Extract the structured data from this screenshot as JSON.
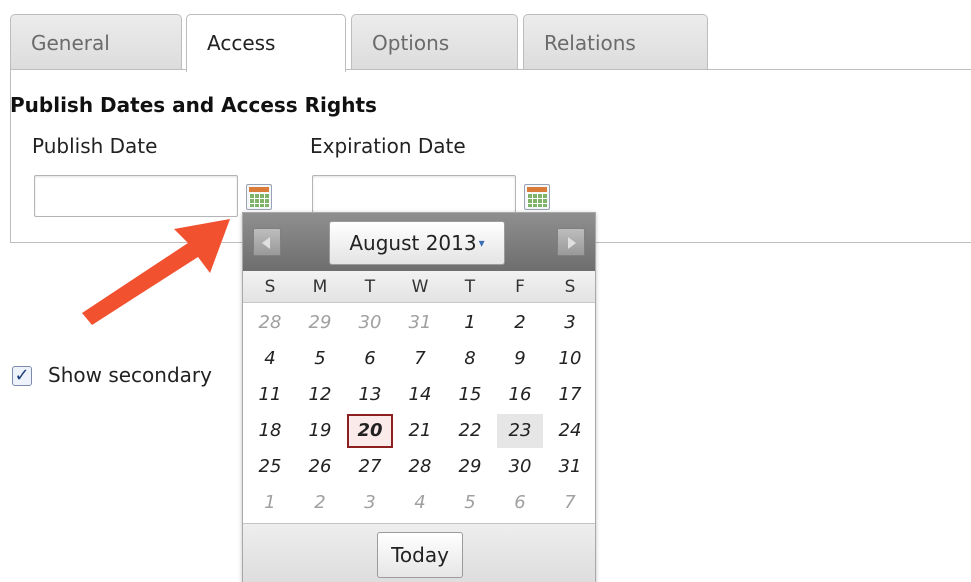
{
  "tabs": [
    {
      "label": "General",
      "active": false
    },
    {
      "label": "Access",
      "active": true
    },
    {
      "label": "Options",
      "active": false
    },
    {
      "label": "Relations",
      "active": false
    }
  ],
  "section": {
    "title": "Publish Dates and Access Rights"
  },
  "fields": {
    "publish_date": {
      "label": "Publish Date",
      "value": ""
    },
    "expiration_date": {
      "label": "Expiration Date",
      "value": ""
    }
  },
  "checkbox": {
    "label": "Show secondary",
    "checked": true
  },
  "datepicker": {
    "month_label": "August 2013",
    "caret": "▾",
    "weekdays": [
      "S",
      "M",
      "T",
      "W",
      "T",
      "F",
      "S"
    ],
    "weeks": [
      [
        "28",
        "29",
        "30",
        "31",
        "1",
        "2",
        "3"
      ],
      [
        "4",
        "5",
        "6",
        "7",
        "8",
        "9",
        "10"
      ],
      [
        "11",
        "12",
        "13",
        "14",
        "15",
        "16",
        "17"
      ],
      [
        "18",
        "19",
        "20",
        "21",
        "22",
        "23",
        "24"
      ],
      [
        "25",
        "26",
        "27",
        "28",
        "29",
        "30",
        "31"
      ],
      [
        "1",
        "2",
        "3",
        "4",
        "5",
        "6",
        "7"
      ]
    ],
    "selected_day": "20",
    "highlighted_day": "23",
    "today_label": "Today"
  },
  "colors": {
    "arrow": "#f2512f",
    "selected_border": "#8c1f1f",
    "header_bg": "#7a7a7a"
  }
}
